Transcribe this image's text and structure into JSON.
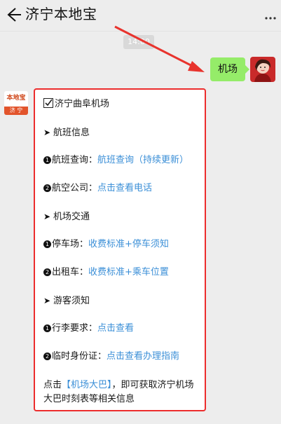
{
  "header": {
    "title": "济宁本地宝"
  },
  "chat": {
    "timestamp": "14:00",
    "my_message": "机场"
  },
  "bot": {
    "avatar_logo_top": "本地宝",
    "avatar_logo_band": "济 宁"
  },
  "card": {
    "heading": "济宁曲阜机场",
    "sections": [
      {
        "title": "航班信息",
        "items": [
          {
            "num": "1",
            "label": "航班查询：",
            "link": "航班查询（持续更新）"
          },
          {
            "num": "2",
            "label": "航空公司：",
            "link": "点击查看电话"
          }
        ]
      },
      {
        "title": "机场交通",
        "items": [
          {
            "num": "1",
            "label": "停车场：",
            "link": "收费标准+停车须知"
          },
          {
            "num": "2",
            "label": "出租车：",
            "link": "收费标准+乘车位置"
          }
        ]
      },
      {
        "title": "游客须知",
        "items": [
          {
            "num": "1",
            "label": "行李要求：",
            "link": "点击查看"
          },
          {
            "num": "2",
            "label": "临时身份证：",
            "link": "点击查看办理指南"
          }
        ]
      }
    ],
    "footer": {
      "prefix": "点击",
      "link": "【机场大巴】",
      "suffix": "，即可获取济宁机场大巴时刻表等相关信息"
    }
  },
  "colors": {
    "accent_link": "#3b8fd7",
    "highlight_border": "#ec2d2d",
    "my_bubble": "#95ec69"
  },
  "icons": [
    "back-arrow-icon",
    "more-dots-icon",
    "checkbox-icon",
    "arrow-bullet-icon"
  ]
}
